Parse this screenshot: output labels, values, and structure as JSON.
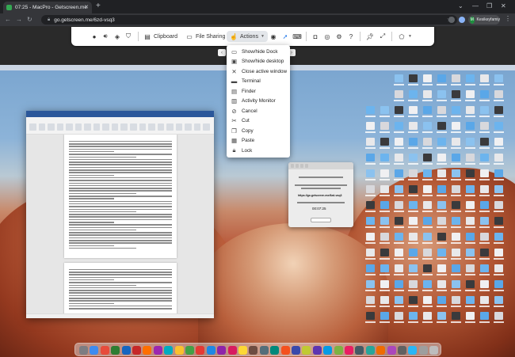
{
  "browser": {
    "tab_title": "07:25 - MacPro - Getscreen.me",
    "url": "go.getscreen.me/6zd-vsq3",
    "profile_initial": "M",
    "profile_name": "Kesikeyfamiy"
  },
  "toolbar": {
    "clipboard_label": "Clipboard",
    "file_sharing_label": "File Sharing",
    "actions_label": "Actions",
    "icons": [
      "user-icon",
      "volume-icon",
      "layers-icon",
      "shield-icon",
      "clipboard-icon",
      "file-sharing-icon",
      "actions-icon",
      "eye-icon",
      "pointer-icon",
      "keyboard-icon",
      "camera-icon",
      "target-icon",
      "settings-icon",
      "help-icon",
      "pin-icon",
      "expand-icon",
      "monitor-icon"
    ]
  },
  "actions_menu": {
    "items": [
      {
        "label": "Show/hide Dock",
        "icon": "dock-icon"
      },
      {
        "label": "Show/hide desktop",
        "icon": "desktop-icon"
      },
      {
        "label": "Close active window",
        "icon": "close-icon"
      },
      {
        "label": "Terminal",
        "icon": "terminal-icon"
      },
      {
        "label": "Finder",
        "icon": "finder-icon"
      },
      {
        "label": "Activity Monitor",
        "icon": "activity-monitor-icon"
      },
      {
        "label": "Cancel",
        "icon": "cancel-icon"
      },
      {
        "label": "Cut",
        "icon": "cut-icon"
      },
      {
        "label": "Copy",
        "icon": "copy-icon"
      },
      {
        "label": "Paste",
        "icon": "paste-icon"
      },
      {
        "label": "Lock",
        "icon": "lock-icon"
      }
    ]
  },
  "remote": {
    "mini_dialog": {
      "code": "https://go.getscreen.me/6zd-vsq3",
      "timer": "00:07:25"
    }
  },
  "colors": {
    "browser_bg": "#202124",
    "tab_bg": "#35363a",
    "toolbar_bg": "#ffffff",
    "word_blue": "#2b579a",
    "profile_green": "#1e8e3e"
  }
}
